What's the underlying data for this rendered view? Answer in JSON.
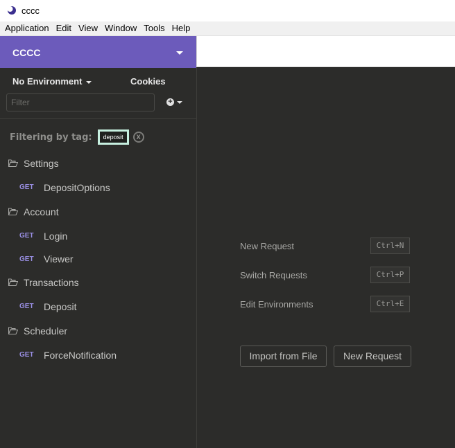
{
  "window": {
    "title": "cccc",
    "icon": "moon-logo-icon"
  },
  "menubar": [
    "Application",
    "Edit",
    "Window",
    "Tools",
    "Help"
  ],
  "menu_items": [
    "Application",
    "Edit",
    "View",
    "Window",
    "Tools",
    "Help"
  ],
  "sidebar": {
    "workspace_name": "CCCC",
    "environment": "No Environment",
    "cookies": "Cookies",
    "filter_placeholder": "Filter",
    "filter_tag_label": "Filtering by tag:",
    "active_tag": "deposit",
    "clear_tag_symbol": "X",
    "tree": [
      {
        "type": "folder",
        "label": "Settings"
      },
      {
        "type": "request",
        "method": "GET",
        "label": "DepositOptions"
      },
      {
        "type": "folder",
        "label": "Account"
      },
      {
        "type": "request",
        "method": "GET",
        "label": "Login"
      },
      {
        "type": "request",
        "method": "GET",
        "label": "Viewer"
      },
      {
        "type": "folder",
        "label": "Transactions"
      },
      {
        "type": "request",
        "method": "GET",
        "label": "Deposit"
      },
      {
        "type": "folder",
        "label": "Scheduler"
      },
      {
        "type": "request",
        "method": "GET",
        "label": "ForceNotification"
      }
    ]
  },
  "main": {
    "shortcuts": [
      {
        "label": "New Request",
        "keys": "Ctrl+N"
      },
      {
        "label": "Switch Requests",
        "keys": "Ctrl+P"
      },
      {
        "label": "Edit Environments",
        "keys": "Ctrl+E"
      }
    ],
    "import_button": "Import from File",
    "new_request_button": "New Request"
  },
  "colors": {
    "accent": "#6c5bbb",
    "sidebar_bg": "#2c2c2a",
    "method_get": "#9b90e6",
    "tag_border": "#c7f0e0"
  }
}
